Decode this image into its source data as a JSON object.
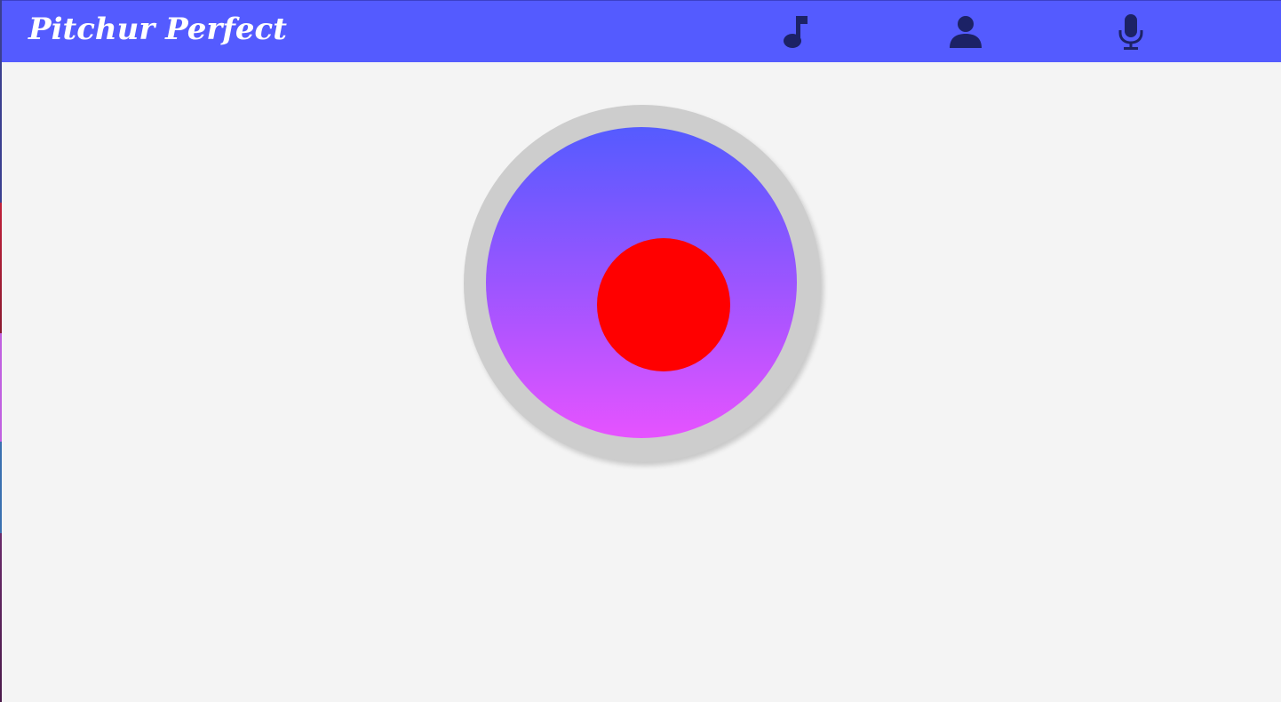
{
  "app": {
    "title": "Pitchur Perfect"
  },
  "nav": {
    "icons": [
      {
        "name": "music-note-icon"
      },
      {
        "name": "user-icon"
      },
      {
        "name": "microphone-icon"
      }
    ]
  },
  "colors": {
    "brand": "#545bff",
    "icon": "#1c2266",
    "gradient_top": "#555bff",
    "gradient_mid": "#9b55ff",
    "gradient_bottom": "#e653ff",
    "record_red": "#ff0000",
    "ring": "#cdcdcd",
    "background": "#f4f4f4"
  },
  "record_button": {
    "icon": "record-dot-icon"
  }
}
